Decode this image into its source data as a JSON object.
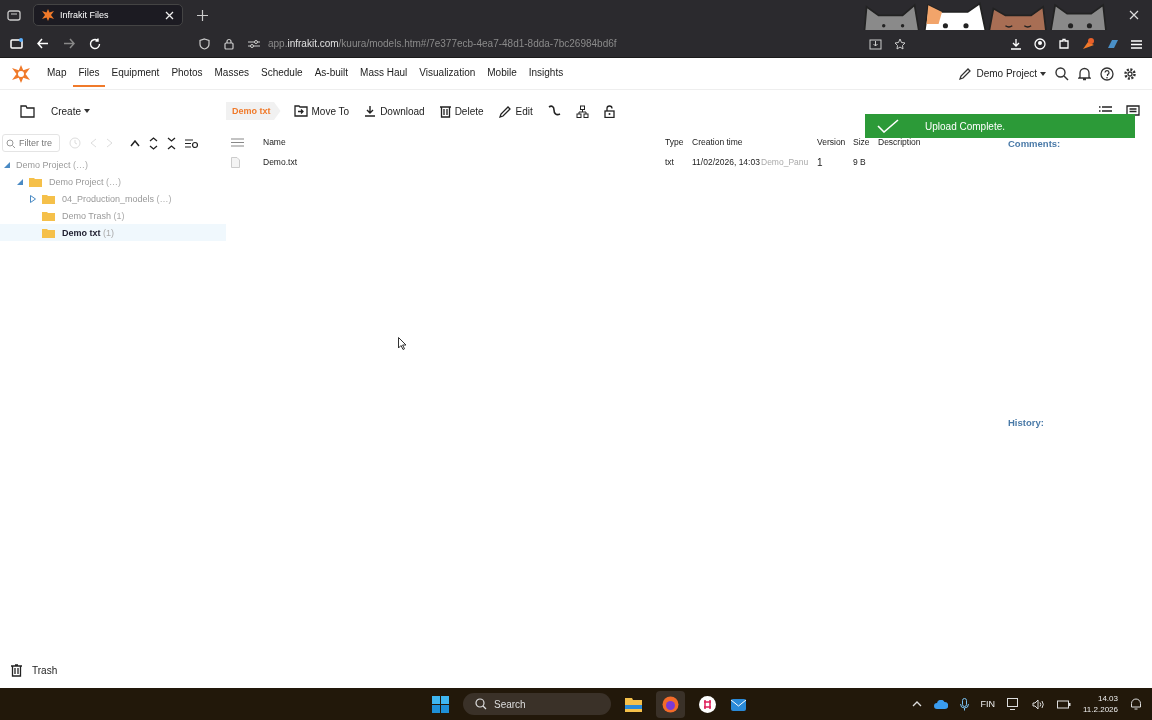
{
  "browser": {
    "tab_title": "Infrakit Files",
    "url_pre": "app.",
    "url_host": "infrakit.com",
    "url_path": "/kuura/models.htm#/7e377ecb-4ea7-48d1-8dda-7bc26984bd6f"
  },
  "nav": {
    "items": [
      {
        "label": "Map",
        "selected": false
      },
      {
        "label": "Files",
        "selected": true
      },
      {
        "label": "Equipment",
        "selected": false
      },
      {
        "label": "Photos",
        "selected": false
      },
      {
        "label": "Masses",
        "selected": false
      },
      {
        "label": "Schedule",
        "selected": false
      },
      {
        "label": "As-built",
        "selected": false
      },
      {
        "label": "Mass Haul",
        "selected": false
      },
      {
        "label": "Visualization",
        "selected": false
      },
      {
        "label": "Mobile",
        "selected": false
      },
      {
        "label": "Insights",
        "selected": false
      }
    ],
    "project": "Demo Project"
  },
  "toolbar": {
    "create": "Create",
    "breadcrumb": "Demo txt",
    "actions": [
      {
        "kind": "move",
        "label": "Move To"
      },
      {
        "kind": "download",
        "label": "Download"
      },
      {
        "kind": "delete",
        "label": "Delete"
      },
      {
        "kind": "edit",
        "label": "Edit"
      },
      {
        "kind": "link"
      },
      {
        "kind": "tree"
      },
      {
        "kind": "lock"
      }
    ]
  },
  "tree": {
    "filter_placeholder": "Filter tre",
    "items": [
      {
        "label": "Demo Project",
        "count": "(…)",
        "folder": false,
        "expanded": true,
        "selected": false,
        "children": [
          {
            "label": "Demo Project",
            "count": "(…)",
            "folder": true,
            "expanded": true,
            "selected": false,
            "children": [
              {
                "label": "04_Production_models",
                "count": "(…)",
                "folder": true,
                "expanded": false,
                "selected": false
              },
              {
                "label": "Demo Trash",
                "count": "(1)",
                "folder": true,
                "selected": false
              },
              {
                "label": "Demo txt",
                "count": "(1)",
                "folder": true,
                "selected": true
              }
            ]
          }
        ]
      }
    ]
  },
  "table": {
    "columns": [
      "Name",
      "Type",
      "Creation time",
      "",
      "Version",
      "Size",
      "Description"
    ],
    "rows": [
      {
        "name": "Demo.txt",
        "type": "txt",
        "created": "11/02/2026, 14:03",
        "owner": "Demo_Panu",
        "version": "1",
        "size": "9 B"
      }
    ]
  },
  "side": {
    "comments": "Comments:",
    "history": "History:"
  },
  "toast": {
    "message": "Upload Complete."
  },
  "trash": "Trash",
  "taskbar": {
    "search": {
      "placeholder": "Search"
    },
    "language": "FIN",
    "time": "14.03",
    "date": "11.2.2026"
  }
}
